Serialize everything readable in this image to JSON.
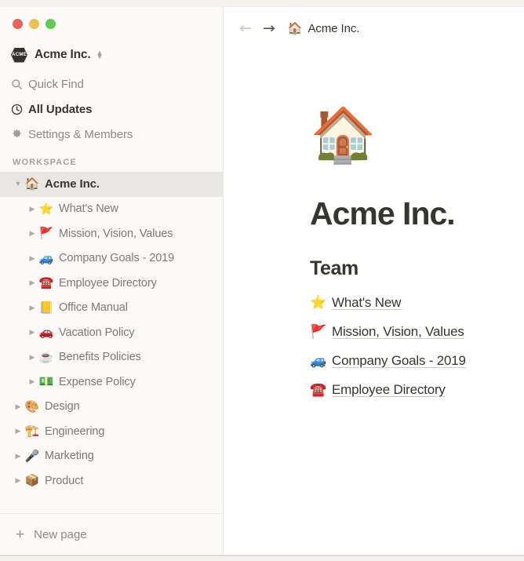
{
  "window": {
    "traffic_lights": [
      {
        "name": "close",
        "color": "#e8615a"
      },
      {
        "name": "minimize",
        "color": "#edc254"
      },
      {
        "name": "zoom",
        "color": "#64c653"
      }
    ]
  },
  "sidebar": {
    "workspace": {
      "badge_text": "ACME",
      "name": "Acme Inc.",
      "switcher_icon": "chevron-up-down-icon"
    },
    "nav": [
      {
        "icon": "search-icon",
        "label": "Quick Find",
        "emphasis": "normal"
      },
      {
        "icon": "clock-icon",
        "label": "All Updates",
        "emphasis": "strong"
      },
      {
        "icon": "gear-icon",
        "label": "Settings & Members",
        "emphasis": "normal"
      }
    ],
    "section_label": "WORKSPACE",
    "tree": [
      {
        "label": "Acme Inc.",
        "emoji": "🏠",
        "depth": 0,
        "twisty": "▼",
        "selected": true
      },
      {
        "label": "What's New",
        "emoji": "⭐",
        "depth": 1,
        "twisty": "▶",
        "selected": false
      },
      {
        "label": "Mission, Vision, Values",
        "emoji": "🚩",
        "depth": 1,
        "twisty": "▶",
        "selected": false
      },
      {
        "label": "Company Goals - 2019",
        "emoji": "🚙",
        "depth": 1,
        "twisty": "▶",
        "selected": false
      },
      {
        "label": "Employee Directory",
        "emoji": "☎️",
        "depth": 1,
        "twisty": "▶",
        "selected": false
      },
      {
        "label": "Office Manual",
        "emoji": "📒",
        "depth": 1,
        "twisty": "▶",
        "selected": false
      },
      {
        "label": "Vacation Policy",
        "emoji": "🚗",
        "depth": 1,
        "twisty": "▶",
        "selected": false
      },
      {
        "label": "Benefits Policies",
        "emoji": "☕",
        "depth": 1,
        "twisty": "▶",
        "selected": false
      },
      {
        "label": "Expense Policy",
        "emoji": "💵",
        "depth": 1,
        "twisty": "▶",
        "selected": false
      },
      {
        "label": "Design",
        "emoji": "🎨",
        "depth": 0,
        "twisty": "▶",
        "selected": false
      },
      {
        "label": "Engineering",
        "emoji": "🏗️",
        "depth": 0,
        "twisty": "▶",
        "selected": false
      },
      {
        "label": "Marketing",
        "emoji": "🎤",
        "depth": 0,
        "twisty": "▶",
        "selected": false
      },
      {
        "label": "Product",
        "emoji": "📦",
        "depth": 0,
        "twisty": "▶",
        "selected": false
      }
    ],
    "new_page": {
      "label": "New page",
      "icon": "plus-icon"
    }
  },
  "main": {
    "topbar": {
      "back_icon": "arrow-left-icon",
      "forward_icon": "arrow-right-icon",
      "breadcrumb": {
        "emoji": "🏠",
        "label": "Acme Inc."
      }
    },
    "page": {
      "icon": "🏠",
      "title": "Acme Inc.",
      "heading": "Team",
      "links": [
        {
          "emoji": "⭐",
          "label": "What's New"
        },
        {
          "emoji": "🚩",
          "label": "Mission, Vision, Values"
        },
        {
          "emoji": "🚙",
          "label": "Company Goals - 2019"
        },
        {
          "emoji": "☎️",
          "label": "Employee Directory"
        }
      ]
    }
  }
}
